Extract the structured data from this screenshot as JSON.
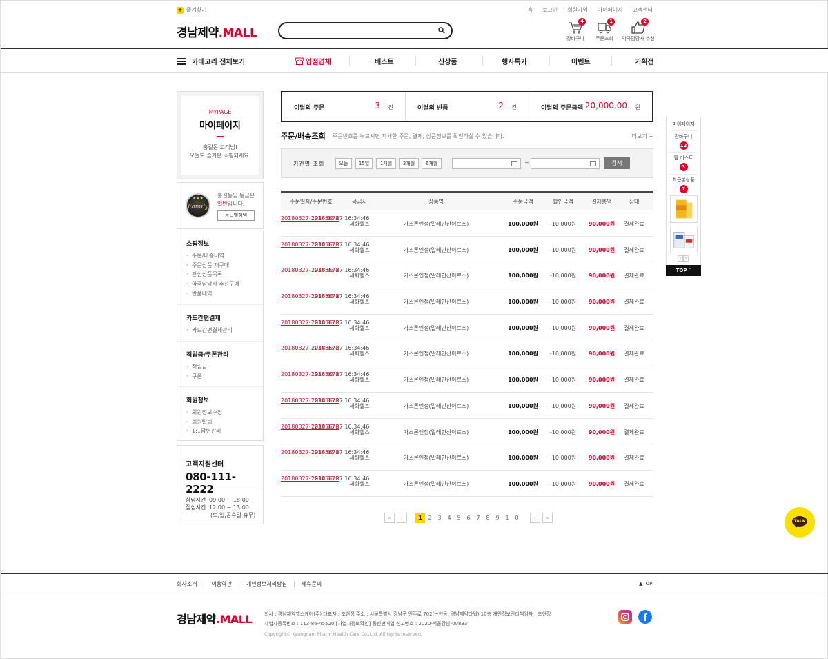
{
  "top": {
    "favorites_label": "즐겨찾기",
    "links": [
      "홈",
      "로그인",
      "회원가입",
      "마이페이지",
      "고객센터"
    ]
  },
  "logo": {
    "text_ko": "경남제약",
    "dot": ".",
    "text_en": "MALL"
  },
  "search": {
    "placeholder": ""
  },
  "header_icons": [
    {
      "label": "장바구니",
      "badge": "4",
      "icon": "cart-icon"
    },
    {
      "label": "주문조회",
      "badge": "1",
      "icon": "truck-icon"
    },
    {
      "label": "약국담당자 추천",
      "badge": "2",
      "icon": "thumbs-up-icon"
    }
  ],
  "gnb": {
    "all_categories": "카테고리 전체보기",
    "menus": [
      "입점업체",
      "베스트",
      "신상품",
      "행사특가",
      "이벤트",
      "기획전"
    ]
  },
  "sidebar": {
    "mypage_en": "MYPAGE",
    "mypage_ko": "마이페이지",
    "greeting_line1": "홍길동 고객님!",
    "greeting_line2": "오늘도 즐거운 쇼핑되세요.",
    "grade_badge_text": "Family",
    "grade_stars": "★★★",
    "grade_text_1": "홍길동님 등급은",
    "grade_name": "일반",
    "grade_text_2": "입니다.",
    "grade_button": "등급별혜택",
    "groups": [
      {
        "title": "쇼핑정보",
        "items": [
          "주문/배송내역",
          "주문상품 재구매",
          "관심상품목록",
          "약국담당자 추천구매",
          "반품내역"
        ]
      },
      {
        "title": "카드간편결제",
        "items": [
          "카드간편결제관리"
        ]
      },
      {
        "title": "적립금/쿠폰관리",
        "items": [
          "적립금",
          "쿠폰"
        ]
      },
      {
        "title": "회원정보",
        "items": [
          "회원정보수정",
          "회원탈퇴",
          "1:1답변관리"
        ]
      }
    ],
    "cs": {
      "title": "고객지원센터",
      "phone": "080-111-2222",
      "consult_label": "상담시간",
      "consult_time": "09:00 ~ 18:00",
      "lunch_label": "점심시간",
      "lunch_time": "12:00 ~ 13:00",
      "holiday_note": "(토,일,공휴일 휴무)"
    }
  },
  "summary": [
    {
      "label": "이달의 주문",
      "value": "3",
      "unit": "건"
    },
    {
      "label": "이달의 반품",
      "value": "2",
      "unit": "건"
    },
    {
      "label": "이달의 주문금액",
      "value": "20,000,00",
      "unit": "원"
    }
  ],
  "section": {
    "title": "주문/배송조회",
    "desc": "주문번호를 누르시면 자세한 주문, 결제, 상품정보를 확인하실 수 있습니다.",
    "more": "더보기 +"
  },
  "filter": {
    "label": "기간별 조회",
    "periods": [
      "오늘",
      "15일",
      "1개월",
      "3개월",
      "6개월"
    ],
    "tilde": "~",
    "start_value": "",
    "end_value": "",
    "search_button": "검색"
  },
  "table": {
    "headers": [
      "주문일자/주문번호",
      "공급사",
      "상품명",
      "주문금액",
      "할인금액",
      "결제총액",
      "상태"
    ],
    "rows": [
      {
        "date": "2018.03.27 16:34:46",
        "order_no": "20180327-12345678",
        "supplier": "세화헬스",
        "product": "가스론엔정(말레인산이르소)",
        "amount": "100,000원",
        "discount": "-10,000원",
        "total": "90,000원",
        "status": "결제완료"
      },
      {
        "date": "2018.03.27 16:34:46",
        "order_no": "20180327-12345678",
        "supplier": "세화헬스",
        "product": "가스론엔정(말레인산이르소)",
        "amount": "100,000원",
        "discount": "-10,000원",
        "total": "90,000원",
        "status": "결제완료"
      },
      {
        "date": "2018.03.27 16:34:46",
        "order_no": "20180327-12345678",
        "supplier": "세화헬스",
        "product": "가스론엔정(말레인산이르소)",
        "amount": "100,000원",
        "discount": "-10,000원",
        "total": "90,000원",
        "status": "결제완료"
      },
      {
        "date": "2018.03.27 16:34:46",
        "order_no": "20180327-12345678",
        "supplier": "세화헬스",
        "product": "가스론엔정(말레인산이르소)",
        "amount": "100,000원",
        "discount": "-10,000원",
        "total": "90,000원",
        "status": "결제완료"
      },
      {
        "date": "2018.03.27 16:34:46",
        "order_no": "20180327-12345678",
        "supplier": "세화헬스",
        "product": "가스론엔정(말레인산이르소)",
        "amount": "100,000원",
        "discount": "-10,000원",
        "total": "90,000원",
        "status": "결제완료"
      },
      {
        "date": "2018.03.27 16:34:46",
        "order_no": "20180327-12345678",
        "supplier": "세화헬스",
        "product": "가스론엔정(말레인산이르소)",
        "amount": "100,000원",
        "discount": "-10,000원",
        "total": "90,000원",
        "status": "결제완료"
      },
      {
        "date": "2018.03.27 16:34:46",
        "order_no": "20180327-12345678",
        "supplier": "세화헬스",
        "product": "가스론엔정(말레인산이르소)",
        "amount": "100,000원",
        "discount": "-10,000원",
        "total": "90,000원",
        "status": "결제완료"
      },
      {
        "date": "2018.03.27 16:34:46",
        "order_no": "20180327-12345678",
        "supplier": "세화헬스",
        "product": "가스론엔정(말레인산이르소)",
        "amount": "100,000원",
        "discount": "-10,000원",
        "total": "90,000원",
        "status": "결제완료"
      },
      {
        "date": "2018.03.27 16:34:46",
        "order_no": "20180327-12345678",
        "supplier": "세화헬스",
        "product": "가스론엔정(말레인산이르소)",
        "amount": "100,000원",
        "discount": "-10,000원",
        "total": "90,000원",
        "status": "결제완료"
      },
      {
        "date": "2018.03.27 16:34:46",
        "order_no": "20180327-12345678",
        "supplier": "세화헬스",
        "product": "가스론엔정(말레인산이르소)",
        "amount": "100,000원",
        "discount": "-10,000원",
        "total": "90,000원",
        "status": "결제완료"
      },
      {
        "date": "2018.03.27 16:34:46",
        "order_no": "20180327-12345678",
        "supplier": "세화헬스",
        "product": "가스론엔정(말레인산이르소)",
        "amount": "100,000원",
        "discount": "-10,000원",
        "total": "90,000원",
        "status": "결제완료"
      }
    ]
  },
  "pagination": {
    "first": "«",
    "prev": "‹",
    "next": "›",
    "last": "»",
    "pages": [
      "1",
      "2",
      "3",
      "4",
      "5",
      "6",
      "7",
      "8",
      "9",
      "1",
      "0"
    ],
    "current": "1"
  },
  "quick": {
    "mypage": "마이페이지",
    "cart_label": "장바구니",
    "cart_count": "12",
    "wish_label": "찜 리스트",
    "wish_count": "3",
    "recent_label": "최근본상품",
    "recent_count": "7",
    "prev": "‹",
    "next": "›",
    "top_label": "TOP ˄"
  },
  "talk_label": "TALK",
  "footer": {
    "links": [
      "회사소개",
      "이용약관",
      "개인정보처리방침",
      "제휴문의"
    ],
    "top_label": "▲TOP",
    "info_line1": "회사 : 경남제약헬스케어(주)    대표자 : 조현정    주소 : 서울특별시 강남구 언주로 702(논현동, 경남제약타워) 10층    개인정보관리책임자 : 조현정",
    "info_line2": "사업자등록번호 : 113-86-45520 [사업자정보확인]    통신판매업 신고번호 : 2020-서울강남-00833",
    "copyright": "Copyright© Kyungnam Pharm Health Care Co.,Ltd. All rights reserved."
  },
  "colors": {
    "accent": "#e4002b",
    "highlight": "#ffd400",
    "kakao": "#f9e000"
  }
}
